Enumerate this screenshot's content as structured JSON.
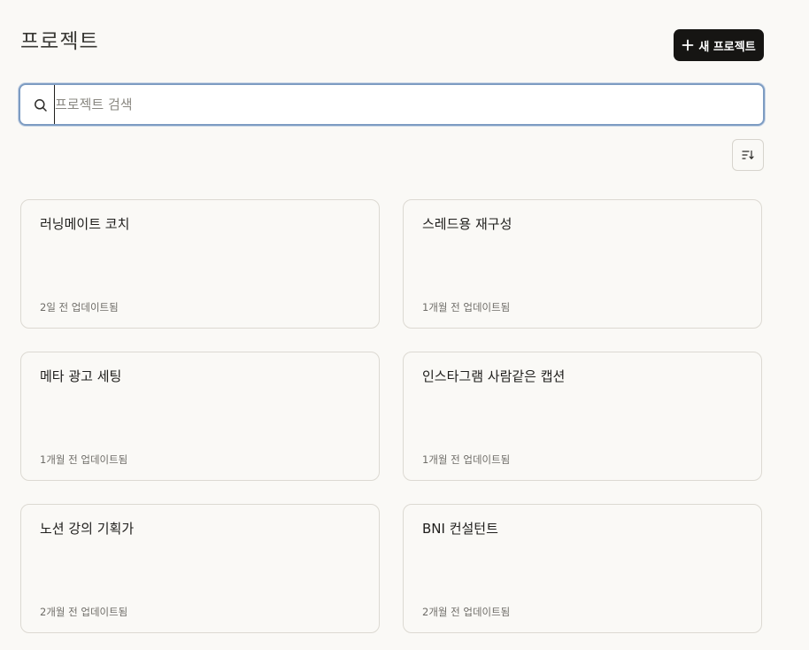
{
  "header": {
    "title": "프로젝트",
    "new_button_label": "새 프로젝트"
  },
  "search": {
    "placeholder": "프로젝트 검색",
    "value": ""
  },
  "sort_button": {
    "icon": "sort-icon"
  },
  "projects": [
    {
      "title": "러닝메이트 코치",
      "updated": "2일 전 업데이트됨"
    },
    {
      "title": "스레드용 재구성",
      "updated": "1개월 전 업데이트됨"
    },
    {
      "title": "메타 광고 세팅",
      "updated": "1개월 전 업데이트됨"
    },
    {
      "title": "인스타그램 사람같은 캡션",
      "updated": "1개월 전 업데이트됨"
    },
    {
      "title": "노션 강의 기획가",
      "updated": "2개월 전 업데이트됨"
    },
    {
      "title": "BNI 컨설턴트",
      "updated": "2개월 전 업데이트됨"
    }
  ],
  "colors": {
    "background": "#faf9f6",
    "primary_button": "#161513",
    "focus_border": "#7d9cc2"
  }
}
